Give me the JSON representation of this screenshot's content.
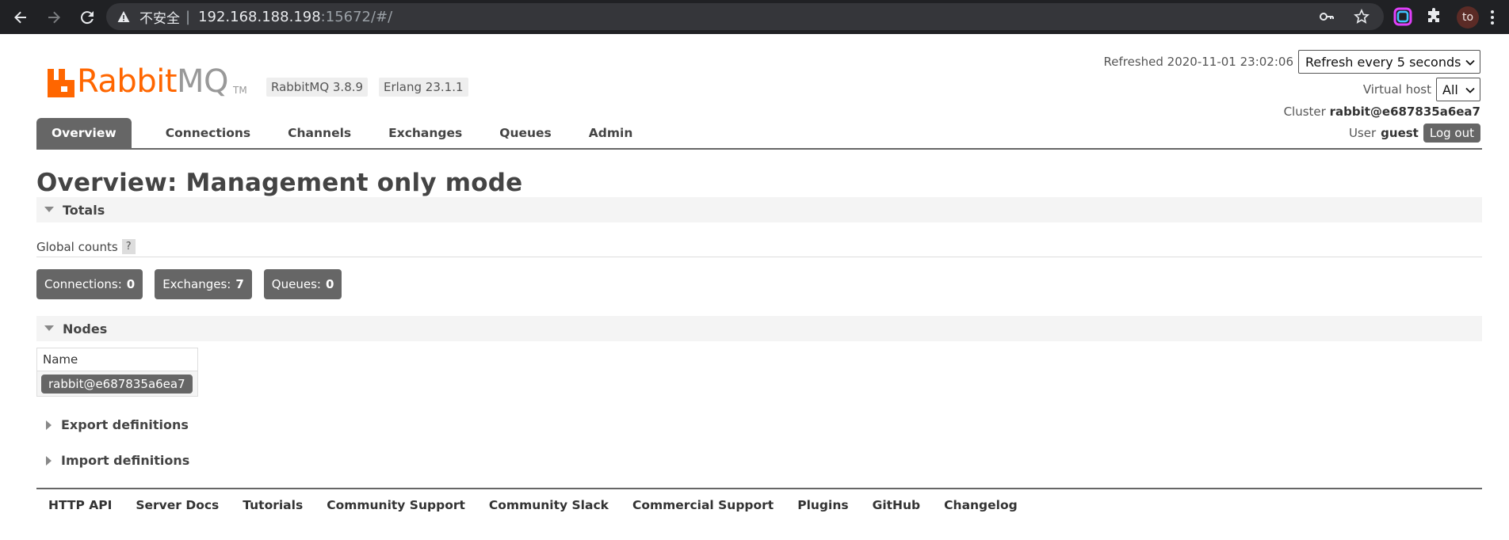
{
  "browser": {
    "security_label": "不安全",
    "url_host": "192.168.188.198",
    "url_rest": ":15672/#/",
    "profile_initials": "to"
  },
  "header": {
    "logo_rabbit": "Rabbit",
    "logo_mq": "MQ",
    "logo_tm": "TM",
    "rabbitmq_version": "RabbitMQ 3.8.9",
    "erlang_version": "Erlang 23.1.1",
    "refreshed_text": "Refreshed 2020-11-01 23:02:06",
    "refresh_option": "Refresh every 5 seconds",
    "vhost_label": "Virtual host",
    "vhost_value": "All",
    "cluster_label": "Cluster",
    "cluster_name": "rabbit@e687835a6ea7",
    "user_label": "User",
    "user_name": "guest",
    "logout_label": "Log out"
  },
  "tabs": [
    {
      "label": "Overview",
      "active": true
    },
    {
      "label": "Connections"
    },
    {
      "label": "Channels"
    },
    {
      "label": "Exchanges"
    },
    {
      "label": "Queues"
    },
    {
      "label": "Admin"
    }
  ],
  "main": {
    "title": "Overview: Management only mode",
    "totals_label": "Totals",
    "global_counts_label": "Global counts",
    "help_label": "?",
    "counts": [
      {
        "label": "Connections:",
        "value": "0"
      },
      {
        "label": "Exchanges:",
        "value": "7"
      },
      {
        "label": "Queues:",
        "value": "0"
      }
    ],
    "nodes_label": "Nodes",
    "nodes_col_name": "Name",
    "node_name": "rabbit@e687835a6ea7",
    "export_label": "Export definitions",
    "import_label": "Import definitions"
  },
  "footer": {
    "links": [
      "HTTP API",
      "Server Docs",
      "Tutorials",
      "Community Support",
      "Community Slack",
      "Commercial Support",
      "Plugins",
      "GitHub",
      "Changelog"
    ]
  },
  "colors": {
    "brand_orange": "#ff6600",
    "tab_active": "#666666",
    "chrome_bg": "#202124"
  }
}
